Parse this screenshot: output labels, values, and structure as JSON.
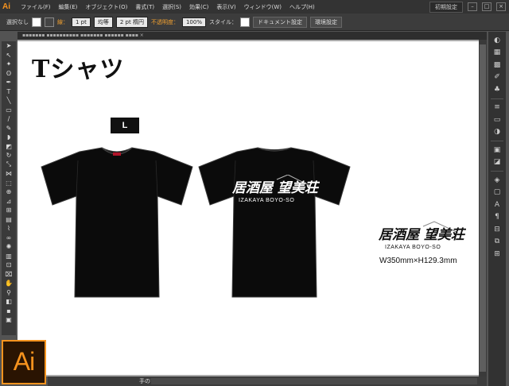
{
  "app": {
    "logo": "Ai"
  },
  "menu": {
    "items": [
      "ファイル(F)",
      "編集(E)",
      "オブジェクト(O)",
      "書式(T)",
      "選択(S)",
      "効果(C)",
      "表示(V)",
      "ウィンドウ(W)",
      "ヘルプ(H)"
    ],
    "workspace": "初期設定"
  },
  "control": {
    "selection": "選択なし",
    "stroke_label": "線：",
    "stroke_weight": "1 pt",
    "stroke_profile": "均等",
    "brush": "2 pt 楕円",
    "opacity_label": "不透明度：",
    "opacity_value": "100%",
    "style_label": "スタイル：",
    "doc_setup": "ドキュメント設定",
    "env_setup": "環境設定"
  },
  "artboard": {
    "title": "Tシャツ",
    "size_badge": "L",
    "dimensions": "W350mm×H129.3mm",
    "print_logo_main": "居酒屋 望美荘",
    "print_logo_sub": "IZAKAYA BOYO-SO"
  },
  "status": {
    "tool": "手のひら"
  },
  "colors": {
    "accent": "#f7931e",
    "shirt": "#0b0b0b",
    "chrome": "#535353"
  }
}
